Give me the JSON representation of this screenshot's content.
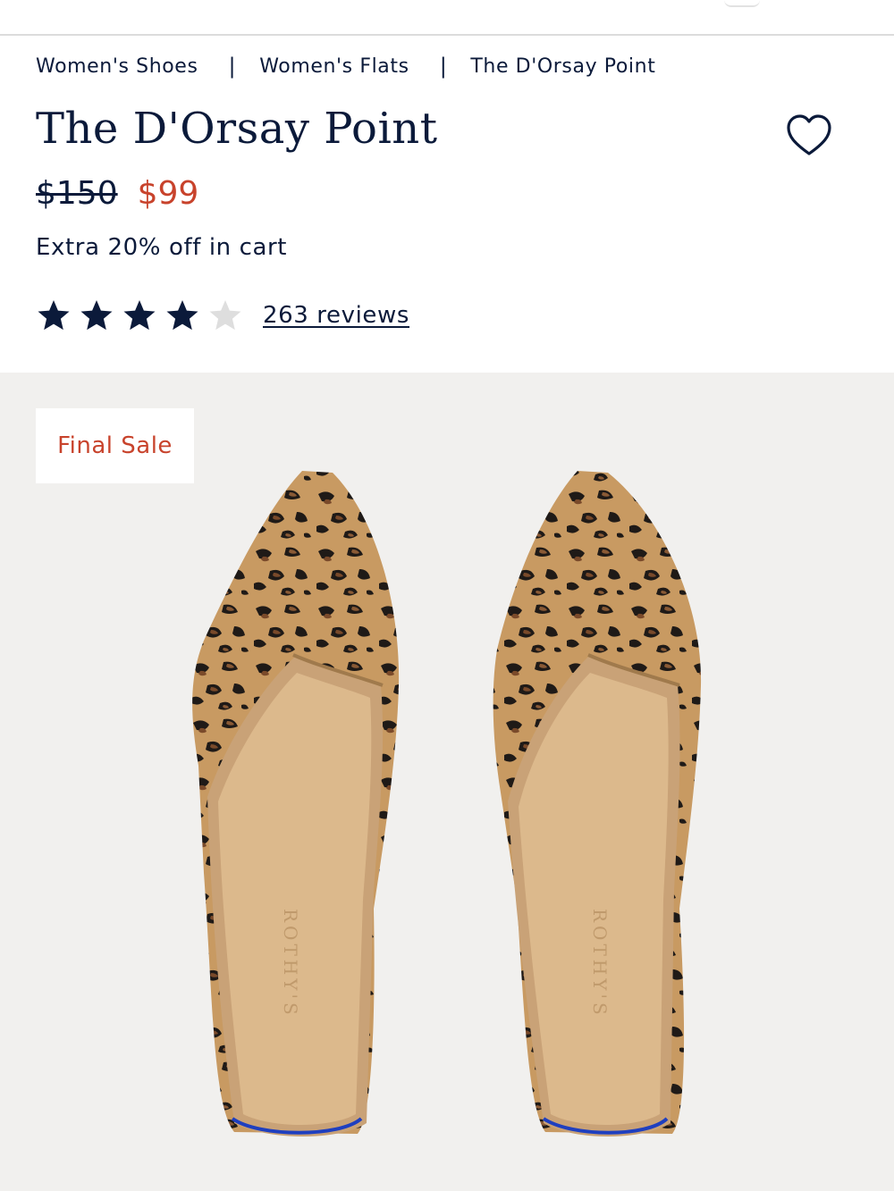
{
  "breadcrumb": {
    "items": [
      {
        "label": "Women's Shoes"
      },
      {
        "label": "Women's Flats"
      },
      {
        "label": "The D'Orsay Point"
      }
    ],
    "separator": "|"
  },
  "product": {
    "title": "The D'Orsay Point",
    "original_price": "$150",
    "sale_price": "$99",
    "promo_text": "Extra 20% off in cart",
    "rating": {
      "stars_filled": 4,
      "stars_total": 5
    },
    "reviews_label": "263 reviews",
    "badge": "Final Sale",
    "insole_brand": "ROTHY'S"
  },
  "icons": {
    "wishlist": "heart-outline-icon",
    "star_filled": "star-filled-icon",
    "star_empty": "star-empty-icon"
  },
  "colors": {
    "navy": "#0b1a3a",
    "sale_red": "#c8432c",
    "gallery_bg": "#f1f0ee",
    "star_empty": "#dedede"
  }
}
